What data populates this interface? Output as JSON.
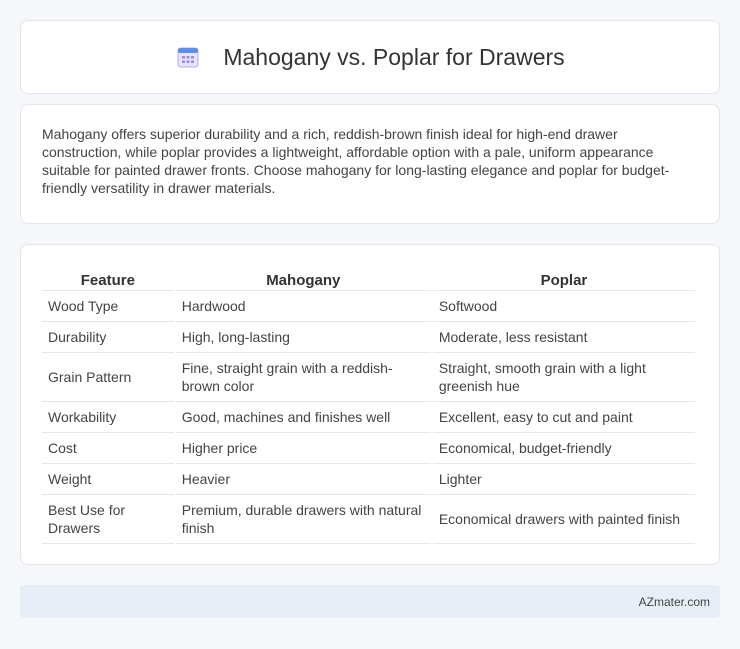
{
  "header": {
    "title": "Mahogany vs. Poplar for Drawers",
    "icon": "calendar-icon"
  },
  "intro": "Mahogany offers superior durability and a rich, reddish-brown finish ideal for high-end drawer construction, while poplar provides a lightweight, affordable option with a pale, uniform appearance suitable for painted drawer fronts. Choose mahogany for long-lasting elegance and poplar for budget-friendly versatility in drawer materials.",
  "table": {
    "headers": [
      "Feature",
      "Mahogany",
      "Poplar"
    ],
    "rows": [
      [
        "Wood Type",
        "Hardwood",
        "Softwood"
      ],
      [
        "Durability",
        "High, long-lasting",
        "Moderate, less resistant"
      ],
      [
        "Grain Pattern",
        "Fine, straight grain with a reddish-brown color",
        "Straight, smooth grain with a light greenish hue"
      ],
      [
        "Workability",
        "Good, machines and finishes well",
        "Excellent, easy to cut and paint"
      ],
      [
        "Cost",
        "Higher price",
        "Economical, budget-friendly"
      ],
      [
        "Weight",
        "Heavier",
        "Lighter"
      ],
      [
        "Best Use for Drawers",
        "Premium, durable drawers with natural finish",
        "Economical drawers with painted finish"
      ]
    ]
  },
  "footer": {
    "site": "AZmater.com"
  }
}
